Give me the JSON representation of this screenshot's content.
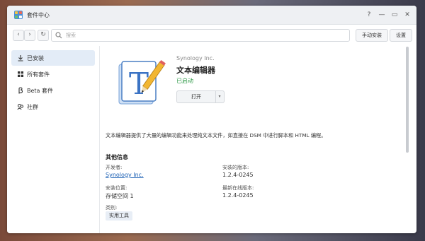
{
  "window": {
    "title": "套件中心",
    "help": "?",
    "minimize": "—",
    "maximize": "▭",
    "close": "✕"
  },
  "toolbar": {
    "back": "‹",
    "forward": "›",
    "refresh": "↻",
    "search_placeholder": "搜索",
    "manual_install_label": "手动安装",
    "settings_label": "设置"
  },
  "sidebar": {
    "items": [
      {
        "label": "已安装",
        "icon": "download-icon",
        "active": true
      },
      {
        "label": "所有套件",
        "icon": "grid-icon",
        "active": false
      },
      {
        "label": "Beta 套件",
        "icon": "beta-icon",
        "active": false
      },
      {
        "label": "社群",
        "icon": "community-icon",
        "active": false
      }
    ]
  },
  "package": {
    "vendor": "Synology Inc.",
    "name": "文本编辑器",
    "status": "已启动",
    "open_label": "打开",
    "dropdown": "▾",
    "description": "文本编辑器提供了大量的编辑功能来处理纯文本文件，如直接在 DSM 中进行脚本和 HTML 编程。",
    "section_title": "其他信息",
    "info": {
      "developer_label": "开发者:",
      "developer_value": "Synology Inc.",
      "installed_version_label": "安装的版本:",
      "installed_version_value": "1.2.4-0245",
      "location_label": "安装位置:",
      "location_value": "存储空间 1",
      "latest_version_label": "最新在线版本:",
      "latest_version_value": "1.2.4-0245",
      "category_label": "类别:",
      "category_value": "实用工具"
    }
  },
  "colors": {
    "accent": "#1a5fb4",
    "status_green": "#2f9a48",
    "sidebar_active": "#e3ecf7"
  }
}
